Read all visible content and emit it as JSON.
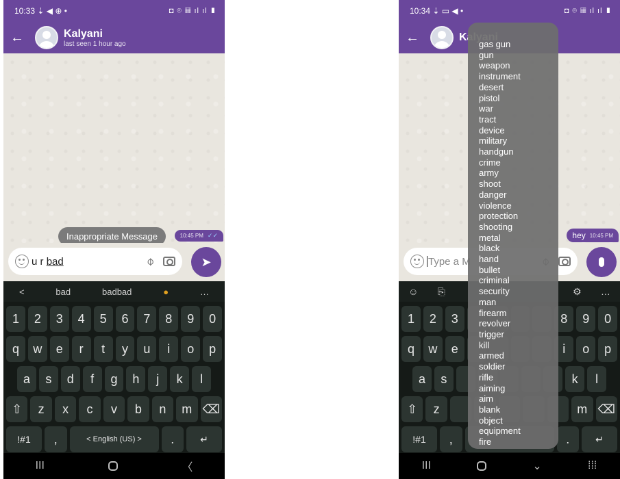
{
  "left": {
    "status": {
      "time": "10:33",
      "left_icons": "⇣ ◀ ⊕ •",
      "right_icons": "◘ ⌾ ▦ ıl ıl ▮"
    },
    "header": {
      "name": "Kalyani",
      "last_seen": "last seen 1 hour ago"
    },
    "bubble": {
      "time": "10:45 PM",
      "ticks": "✓✓"
    },
    "toast": "Inappropriate Message",
    "input": {
      "prefix": "u r ",
      "word": "bad"
    },
    "suggestions": [
      "<",
      "bad",
      "badbad",
      "…"
    ],
    "number_row": [
      "1",
      "2",
      "3",
      "4",
      "5",
      "6",
      "7",
      "8",
      "9",
      "0"
    ],
    "row1": [
      "q",
      "w",
      "e",
      "r",
      "t",
      "y",
      "u",
      "i",
      "o",
      "p"
    ],
    "row2": [
      "a",
      "s",
      "d",
      "f",
      "g",
      "h",
      "j",
      "k",
      "l"
    ],
    "row3": [
      "⇧",
      "z",
      "x",
      "c",
      "v",
      "b",
      "n",
      "m",
      "⌫"
    ],
    "bottom_row": [
      "!#1",
      ",",
      "<   English (US)   >",
      ".",
      "↵"
    ],
    "nav": [
      "III",
      "〈"
    ]
  },
  "right": {
    "status": {
      "time": "10:34",
      "left_icons": "⇣ ▭ ◀ •",
      "right_icons": "◘ ⌾ ▦ ıl ıl ▮"
    },
    "header": {
      "name": "Kalyani"
    },
    "bubble": {
      "text": "hey",
      "time": "10:45 PM"
    },
    "input": {
      "placeholder": "Type a M"
    },
    "toolbar": [
      "☺",
      "⎘",
      "⚙",
      "…"
    ],
    "number_row": [
      "1",
      "2",
      "3",
      "8",
      "9",
      "0"
    ],
    "row1": [
      "q",
      "w",
      "e",
      "i",
      "o",
      "p"
    ],
    "row2": [
      "a",
      "s",
      "k",
      "l"
    ],
    "row3": [
      "⇧",
      "z",
      "m",
      "⌫"
    ],
    "bottom_row": [
      "!#1",
      ",",
      ".",
      "↵"
    ],
    "nav": [
      "III",
      "⌄",
      "⁞⁞⁞"
    ]
  },
  "word_list": [
    "gas gun",
    "gun",
    "weapon",
    "instrument",
    "desert",
    "pistol",
    "war",
    "tract",
    "device",
    "military",
    "handgun",
    "crime",
    "army",
    "shoot",
    "danger",
    "violence",
    "protection",
    "shooting",
    "metal",
    "black",
    "hand",
    "bullet",
    "criminal",
    "security",
    "man",
    "firearm",
    "revolver",
    "trigger",
    "kill",
    "armed",
    "soldier",
    "rifle",
    "aiming",
    "aim",
    "blank",
    "object",
    "equipment",
    "fire"
  ],
  "colors": {
    "accent": "#6a479c",
    "keyboard": "#151a17",
    "key": "#2c3531",
    "overlay": "#6e6e6e"
  },
  "icons": [
    "back-arrow-icon",
    "emoji-icon",
    "attach-icon",
    "camera-icon",
    "send-icon",
    "mic-icon",
    "home-icon",
    "recents-icon"
  ]
}
